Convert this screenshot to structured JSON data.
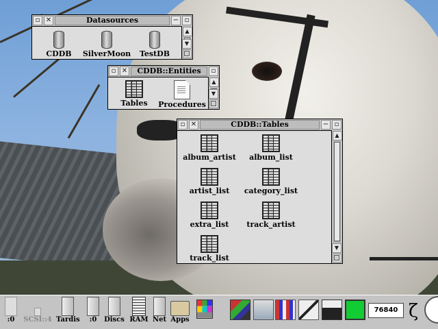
{
  "windows": {
    "datasources": {
      "title": "Datasources",
      "items": [
        {
          "label": "CDDB",
          "icon": "database-icon"
        },
        {
          "label": "SilverMoon",
          "icon": "database-icon"
        },
        {
          "label": "TestDB",
          "icon": "database-icon"
        }
      ]
    },
    "entities": {
      "title": "CDDB::Entities",
      "items": [
        {
          "label": "Tables",
          "icon": "table-icon"
        },
        {
          "label": "Procedures",
          "icon": "document-icon"
        }
      ]
    },
    "tables": {
      "title": "CDDB::Tables",
      "items": [
        {
          "label": "album_artist"
        },
        {
          "label": "album_list"
        },
        {
          "label": "artist_list"
        },
        {
          "label": "category_list"
        },
        {
          "label": "extra_list"
        },
        {
          "label": "track_artist"
        },
        {
          "label": "track_list"
        }
      ]
    }
  },
  "iconbar": {
    "items": [
      {
        "label": ":0",
        "icon": "floppy-drive-icon",
        "dim": false
      },
      {
        "label": "SCSI::4",
        "icon": "scsi-drive-icon",
        "dim": true
      },
      {
        "label": "Tardis",
        "icon": "hard-drive-icon",
        "dim": false
      },
      {
        "label": ":0",
        "icon": "drive-icon",
        "dim": false
      },
      {
        "label": "Discs",
        "icon": "discs-icon",
        "dim": false
      },
      {
        "label": "RAM",
        "icon": "ram-icon",
        "dim": false
      },
      {
        "label": "Net",
        "icon": "net-icon",
        "dim": false
      },
      {
        "label": "Apps",
        "icon": "apps-icon",
        "dim": false
      }
    ],
    "clock": "76840",
    "zeta": "ζ"
  }
}
